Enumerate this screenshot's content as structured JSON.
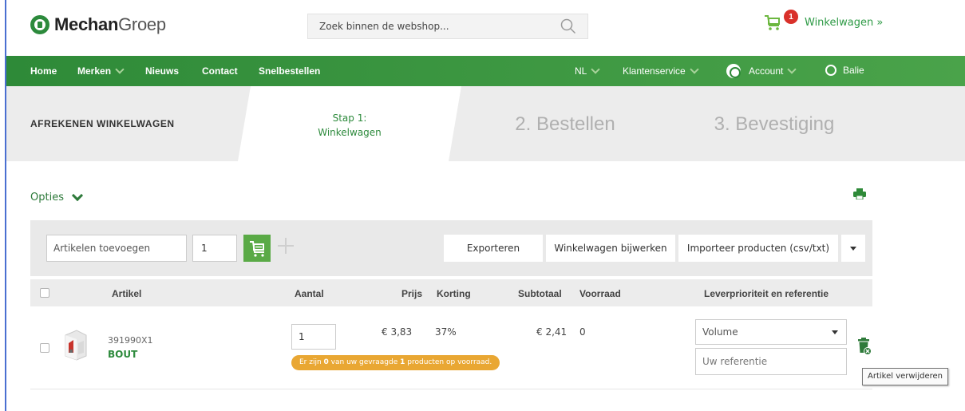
{
  "header": {
    "logo_bold": "Mechan",
    "logo_light": "Groep",
    "search_placeholder": "Zoek binnen de webshop...",
    "cart_count": "1",
    "cart_label": "Winkelwagen »"
  },
  "nav": {
    "home": "Home",
    "merken": "Merken",
    "nieuws": "Nieuws",
    "contact": "Contact",
    "snelbestellen": "Snelbestellen",
    "language": "NL",
    "klantenservice": "Klantenservice",
    "account": "Account",
    "balie": "Balie"
  },
  "steps": {
    "section_title": "AFREKENEN WINKELWAGEN",
    "step1_line1": "Stap 1:",
    "step1_line2": "Winkelwagen",
    "step2": "2. Bestellen",
    "step3": "3. Bevestiging"
  },
  "options": {
    "label": "Opties"
  },
  "toolbar": {
    "add_placeholder": "Artikelen toevoegen",
    "add_qty": "1",
    "export_label": "Exporteren",
    "update_label": "Winkelwagen bijwerken",
    "import_label": "Importeer producten (csv/txt)"
  },
  "table": {
    "headers": {
      "article": "Artikel",
      "quantity": "Aantal",
      "price": "Prijs",
      "discount": "Korting",
      "subtotal": "Subtotaal",
      "stock": "Voorraad",
      "priority": "Leverprioriteit en referentie"
    },
    "rows": [
      {
        "code": "391990X1",
        "name": "BOUT",
        "quantity": "1",
        "stock_message_prefix": "Er zijn ",
        "stock_available": "0",
        "stock_message_mid": " van uw gevraagde ",
        "stock_requested": "1",
        "stock_message_suffix": " producten op voorraad.",
        "price": "€ 3,83",
        "discount": "37%",
        "subtotal": "€ 2,41",
        "stock": "0",
        "priority_value": "Volume",
        "reference_placeholder": "Uw referentie"
      }
    ]
  },
  "tooltip": {
    "text": "Artikel verwijderen"
  },
  "colors": {
    "brand_green": "#2e8a38",
    "accent_orange": "#e9a733",
    "badge_red": "#d9302a"
  }
}
